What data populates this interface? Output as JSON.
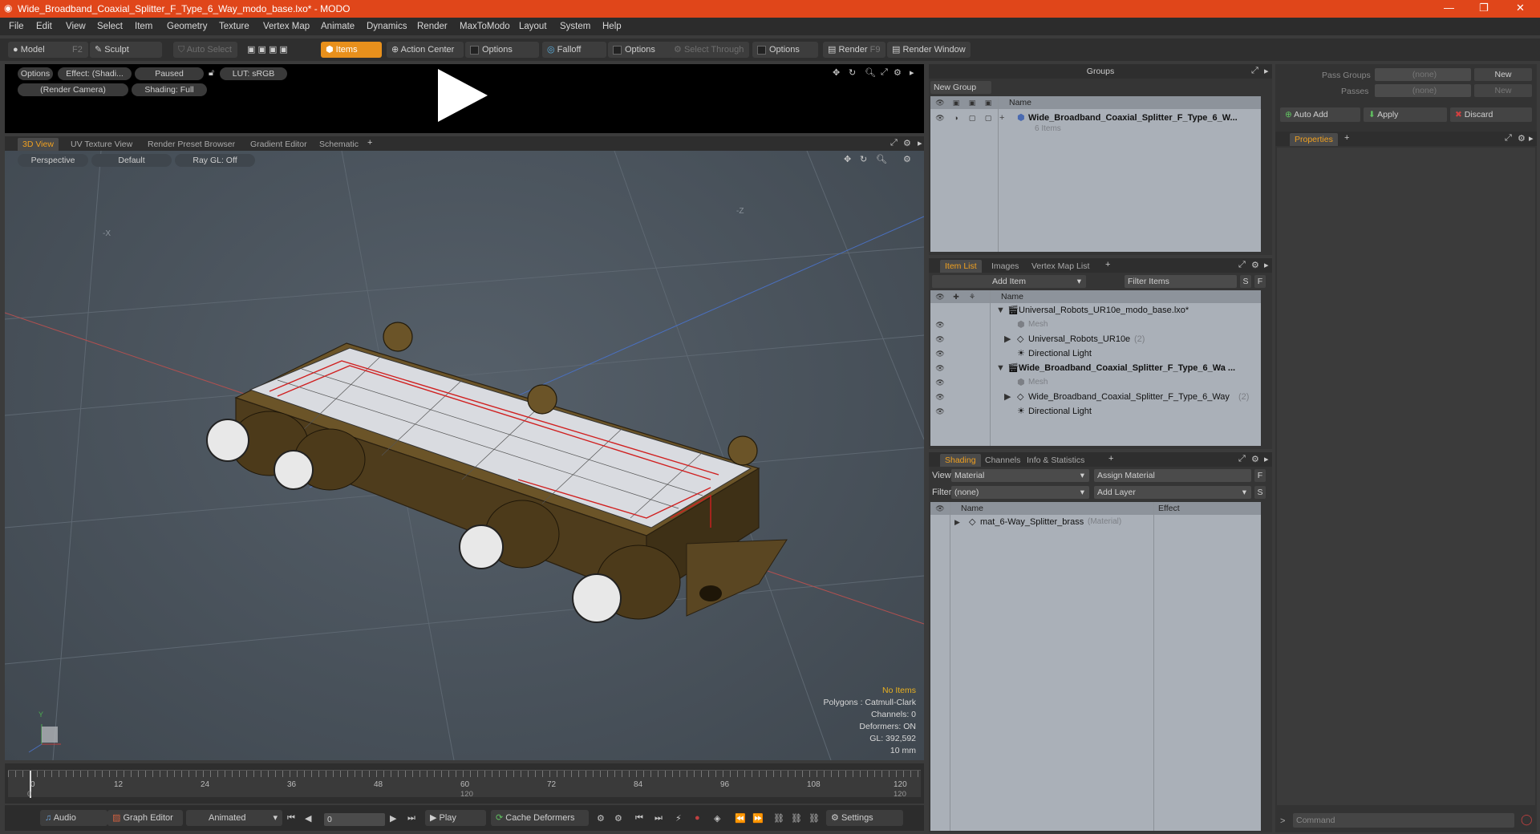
{
  "window": {
    "title": "Wide_Broadband_Coaxial_Splitter_F_Type_6_Way_modo_base.lxo* - MODO"
  },
  "menu": [
    "File",
    "Edit",
    "View",
    "Select",
    "Item",
    "Geometry",
    "Texture",
    "Vertex Map",
    "Animate",
    "Dynamics",
    "Render",
    "MaxToModo",
    "Layout",
    "System",
    "Help"
  ],
  "toolbar": {
    "model": "Model",
    "model_key": "F2",
    "sculpt": "Sculpt",
    "auto_select": "Auto Select",
    "items": "Items",
    "action_center": "Action Center",
    "options1": "Options",
    "falloff": "Falloff",
    "options2": "Options",
    "select_through": "Select Through",
    "options3": "Options",
    "render": "Render",
    "render_key": "F9",
    "render_window": "Render Window"
  },
  "preview": {
    "options": "Options",
    "effect": "Effect: (Shadi...",
    "paused": "Paused",
    "lut": "LUT: sRGB",
    "camera": "(Render Camera)",
    "shading": "Shading: Full"
  },
  "viewport_tabs": [
    "3D View",
    "UV Texture View",
    "Render Preset Browser",
    "Gradient Editor",
    "Schematic"
  ],
  "viewport": {
    "perspective": "Perspective",
    "default": "Default",
    "raygl": "Ray GL: Off",
    "axis_x": "-X",
    "axis_z": "-Z",
    "axis_y": "Y"
  },
  "overlay": {
    "no_items": "No Items",
    "polygons": "Polygons : Catmull-Clark",
    "channels": "Channels: 0",
    "deformers": "Deformers: ON",
    "gl": "GL: 392,592",
    "scale": "10 mm"
  },
  "timeline": {
    "ticks": [
      "0",
      "12",
      "24",
      "36",
      "48",
      "60",
      "72",
      "84",
      "96",
      "108",
      "120"
    ],
    "sub_start": "0",
    "sub_mid": "120",
    "sub_end": "120"
  },
  "bottombar": {
    "audio": "Audio",
    "graph_editor": "Graph Editor",
    "animated": "Animated",
    "frame": "0",
    "play": "Play",
    "cache_deformers": "Cache Deformers",
    "settings": "Settings"
  },
  "groups": {
    "title": "Groups",
    "new_group": "New Group",
    "col_name": "Name",
    "item_name": "Wide_Broadband_Coaxial_Splitter_F_Type_6_W...",
    "item_sub": "6 Items"
  },
  "item_list": {
    "tabs": [
      "Item List",
      "Images",
      "Vertex Map List"
    ],
    "add_item": "Add Item",
    "filter": "Filter Items",
    "s": "S",
    "f": "F",
    "col_name": "Name",
    "rows": [
      {
        "label": "Universal_Robots_UR10e_modo_base.lxo*",
        "count": ""
      },
      {
        "label": "Mesh",
        "count": ""
      },
      {
        "label": "Universal_Robots_UR10e",
        "count": "(2)"
      },
      {
        "label": "Directional Light",
        "count": ""
      },
      {
        "label": "Wide_Broadband_Coaxial_Splitter_F_Type_6_Wa ...",
        "count": ""
      },
      {
        "label": "Mesh",
        "count": ""
      },
      {
        "label": "Wide_Broadband_Coaxial_Splitter_F_Type_6_Way",
        "count": "(2)"
      },
      {
        "label": "Directional Light",
        "count": ""
      }
    ]
  },
  "shading": {
    "tabs": [
      "Shading",
      "Channels",
      "Info & Statistics"
    ],
    "view_label": "View",
    "view_value": "Material",
    "assign": "Assign Material",
    "filter_label": "Filter",
    "filter_value": "(none)",
    "add_layer": "Add Layer",
    "f": "F",
    "s": "S",
    "col_name": "Name",
    "col_effect": "Effect",
    "row_name": "mat_6-Way_Splitter_brass",
    "row_type": "(Material)"
  },
  "right": {
    "pass_groups": "Pass Groups",
    "pass_groups_val": "(none)",
    "new1": "New",
    "passes": "Passes",
    "passes_val": "(none)",
    "new2": "New",
    "auto_add": "Auto Add",
    "apply": "Apply",
    "discard": "Discard",
    "properties": "Properties",
    "command": "Command"
  },
  "colors": {
    "accent": "#e0461a",
    "active_tab": "#f0a020",
    "brass": "#6b5428"
  }
}
